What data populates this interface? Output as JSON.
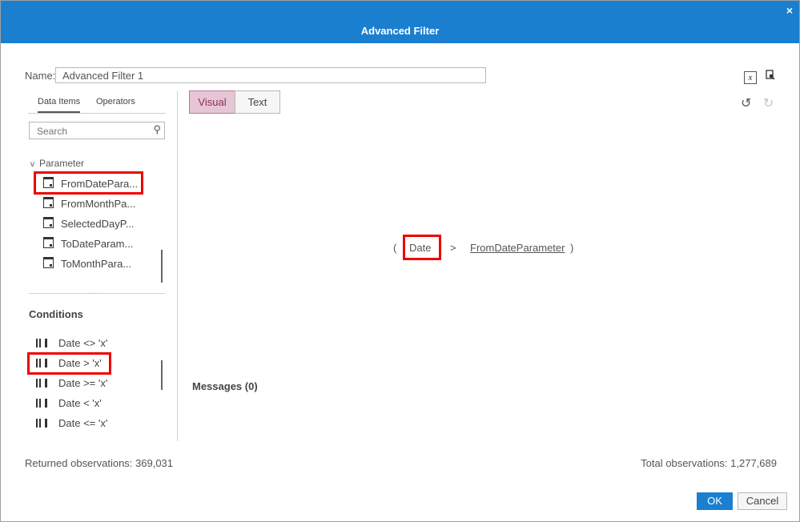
{
  "dialog": {
    "title": "Advanced Filter",
    "close_glyph": "×"
  },
  "name": {
    "label": "Name:",
    "value": "Advanced Filter 1"
  },
  "toolbar": {
    "expression_icon": "x",
    "icons": [
      "expression-icon",
      "inspect-icon",
      "undo-icon",
      "redo-icon"
    ]
  },
  "left_panel": {
    "tabs": [
      "Data Items",
      "Operators"
    ],
    "search": {
      "placeholder": "Search"
    },
    "parameter_group": {
      "label": "Parameter",
      "chevron": "v"
    },
    "parameters": [
      {
        "label": "FromDatePara..."
      },
      {
        "label": "FromMonthPa..."
      },
      {
        "label": "SelectedDayP..."
      },
      {
        "label": "ToDateParam..."
      },
      {
        "label": "ToMonthPara..."
      }
    ],
    "ellipsis": "....",
    "conditions_title": "Conditions",
    "conditions": [
      {
        "label": "Date <> 'x'"
      },
      {
        "label": "Date > 'x'"
      },
      {
        "label": "Date >= 'x'"
      },
      {
        "label": "Date < 'x'"
      },
      {
        "label": "Date <= 'x'"
      }
    ]
  },
  "view_toggle": {
    "visual": "Visual",
    "text": "Text"
  },
  "expression": {
    "open_paren": "(",
    "item": "Date",
    "operator": ">",
    "parameter": "FromDateParameter",
    "close_paren": ")"
  },
  "messages": {
    "label": "Messages (0)"
  },
  "footer": {
    "returned": "Returned observations:  369,031",
    "total": "Total observations:  1,277,689",
    "ok": "OK",
    "cancel": "Cancel"
  },
  "colors": {
    "titlebar": "#1b7fd0",
    "highlight": "#e00000",
    "visual_active": "#e6c5d4"
  }
}
